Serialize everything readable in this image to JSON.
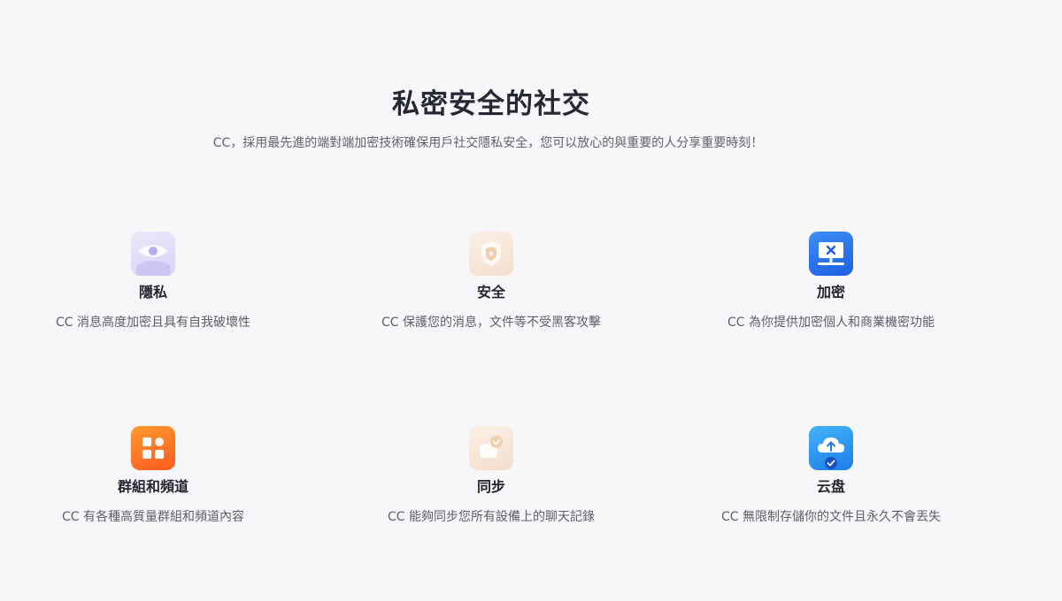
{
  "hero": {
    "title": "私密安全的社交",
    "subtitle": "CC，採用最先進的端對端加密技術確保用戶社交隱私安全，您可以放心的與重要的人分享重要時刻！"
  },
  "features": {
    "privacy": {
      "title": "隱私",
      "desc": "CC 消息高度加密且具有自我破壞性",
      "icon": "eye-icon"
    },
    "security": {
      "title": "安全",
      "desc": "CC 保護您的消息，文件等不受黑客攻擊",
      "icon": "shield-icon"
    },
    "encrypt": {
      "title": "加密",
      "desc": "CC 為你提供加密個人和商業機密功能",
      "icon": "encrypted-screen-icon"
    },
    "groups": {
      "title": "群組和頻道",
      "desc": "CC 有各種高質量群組和頻道內容",
      "icon": "group-grid-icon"
    },
    "sync": {
      "title": "同步",
      "desc": "CC 能夠同步您所有設備上的聊天記錄",
      "icon": "sync-chat-icon"
    },
    "cloud": {
      "title": "云盘",
      "desc": "CC 無限制存儲你的文件且永久不會丟失",
      "icon": "cloud-upload-icon"
    }
  },
  "colors": {
    "background": "#f7f7fa",
    "title": "#262835",
    "encrypt_blue": "#1e5fe0",
    "groups_orange": "#ff6a1f",
    "cloud_blue": "#1a7de8"
  }
}
